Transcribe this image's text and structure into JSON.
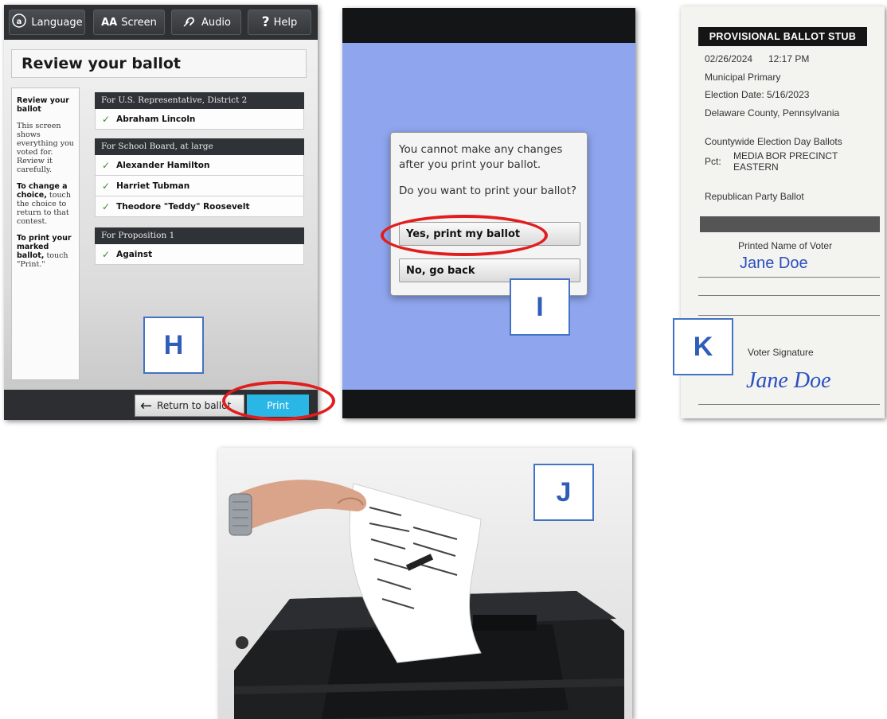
{
  "panel_h": {
    "label": "H",
    "toolbar": {
      "language": "Language",
      "screen_icon": "AA",
      "screen": "Screen",
      "audio": "Audio",
      "help_icon": "?",
      "help": "Help"
    },
    "title": "Review your ballot",
    "sidebar": {
      "heading": "Review your ballot",
      "intro": "This screen shows everything you voted for. Review it carefully.",
      "change_bold": "To change a choice,",
      "change_text": "touch the choice to return to that contest.",
      "print_bold": "To print your marked ballot,",
      "print_text": "touch \"Print.\""
    },
    "contests": [
      {
        "title": "For U.S. Representative, District 2",
        "choices": [
          "Abraham Lincoln"
        ]
      },
      {
        "title": "For School Board, at large",
        "choices": [
          "Alexander Hamilton",
          "Harriet Tubman",
          "Theodore \"Teddy\" Roosevelt"
        ]
      },
      {
        "title": "For Proposition 1",
        "choices": [
          "Against"
        ]
      }
    ],
    "return_button": "Return to ballot",
    "print_button": "Print"
  },
  "panel_i": {
    "label": "I",
    "message": "You cannot make any changes after you print your ballot.",
    "question": "Do you want to print your ballot?",
    "yes_button": "Yes, print my ballot",
    "no_button": "No, go back"
  },
  "panel_k": {
    "label": "K",
    "header": "PROVISIONAL BALLOT STUB",
    "date": "02/26/2024",
    "time": "12:17 PM",
    "election_type": "Municipal Primary",
    "election_date": "Election Date: 5/16/2023",
    "county": "Delaware County, Pennsylvania",
    "ballot_type": "Countywide Election Day Ballots",
    "pct_label": "Pct:",
    "pct_line1": "MEDIA BOR PRECINCT",
    "pct_line2": "EASTERN",
    "party": "Republican Party Ballot",
    "printed_name_label": "Printed Name of Voter",
    "printed_name": "Jane Doe",
    "signature_label": "Voter Signature",
    "signature": "Jane Doe"
  },
  "panel_j": {
    "label": "J"
  },
  "colors": {
    "label_border": "#4472c4",
    "highlight_ring": "#e11d1d",
    "print_button": "#2bb7e6",
    "screen_background": "#8fa6ef"
  }
}
